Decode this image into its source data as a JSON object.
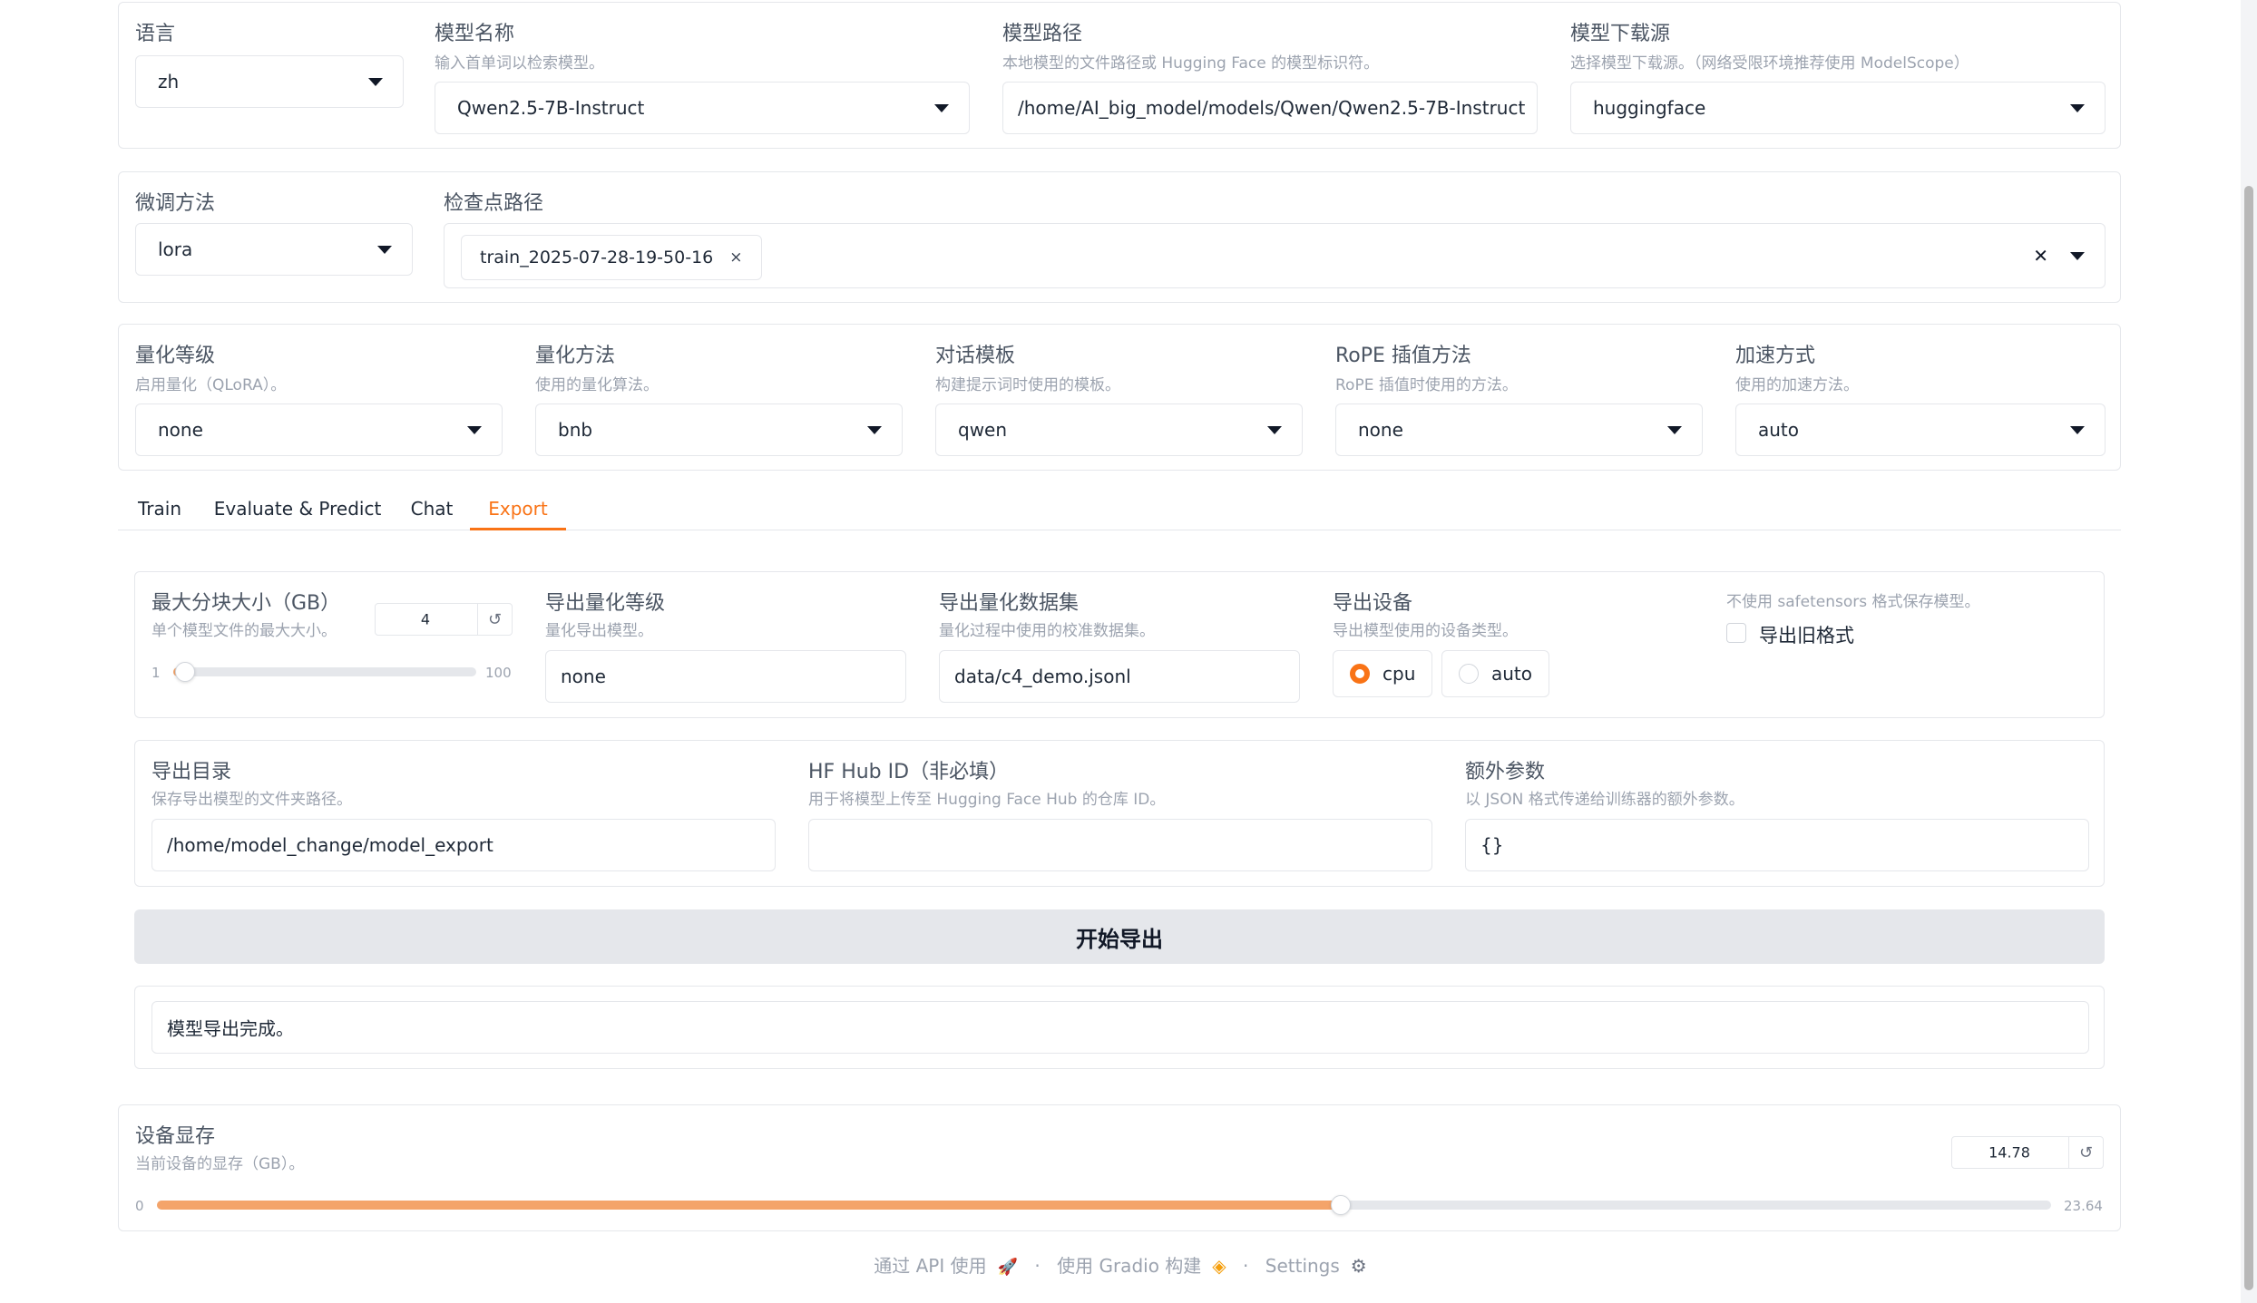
{
  "top": {
    "language": {
      "label": "语言",
      "value": "zh"
    },
    "model_name": {
      "label": "模型名称",
      "info": "输入首单词以检索模型。",
      "value": "Qwen2.5-7B-Instruct"
    },
    "model_path": {
      "label": "模型路径",
      "info": "本地模型的文件路径或 Hugging Face 的模型标识符。",
      "value": "/home/AI_big_model/models/Qwen/Qwen2.5-7B-Instruct"
    },
    "hub": {
      "label": "模型下载源",
      "info": "选择模型下载源。（网络受限环境推荐使用 ModelScope）",
      "value": "huggingface"
    }
  },
  "finetune": {
    "method": {
      "label": "微调方法",
      "value": "lora"
    },
    "checkpoint": {
      "label": "检查点路径",
      "chips": [
        "train_2025-07-28-19-50-16"
      ]
    }
  },
  "advanced": {
    "quant_bit": {
      "label": "量化等级",
      "info": "启用量化（QLoRA）。",
      "value": "none"
    },
    "quant_method": {
      "label": "量化方法",
      "info": "使用的量化算法。",
      "value": "bnb"
    },
    "template": {
      "label": "对话模板",
      "info": "构建提示词时使用的模板。",
      "value": "qwen"
    },
    "rope": {
      "label": "RoPE 插值方法",
      "info": "RoPE 插值时使用的方法。",
      "value": "none"
    },
    "booster": {
      "label": "加速方式",
      "info": "使用的加速方法。",
      "value": "auto"
    }
  },
  "tabs": [
    "Train",
    "Evaluate & Predict",
    "Chat",
    "Export"
  ],
  "export": {
    "shard_size": {
      "label": "最大分块大小（GB）",
      "info": "单个模型文件的最大大小。",
      "value": "4",
      "min": "1",
      "max": "100",
      "fraction": 0.03
    },
    "export_quant_bit": {
      "label": "导出量化等级",
      "info": "量化导出模型。",
      "value": "none"
    },
    "quant_dataset": {
      "label": "导出量化数据集",
      "info": "量化过程中使用的校准数据集。",
      "value": "data/c4_demo.jsonl"
    },
    "device": {
      "label": "导出设备",
      "info": "导出模型使用的设备类型。",
      "options": [
        "cpu",
        "auto"
      ],
      "selected": "cpu"
    },
    "legacy": {
      "info": "不使用 safetensors 格式保存模型。",
      "label": "导出旧格式",
      "checked": false
    },
    "export_dir": {
      "label": "导出目录",
      "info": "保存导出模型的文件夹路径。",
      "value": "/home/model_change/model_export"
    },
    "hub_id": {
      "label": "HF Hub ID（非必填）",
      "info": "用于将模型上传至 Hugging Face Hub 的仓库 ID。",
      "value": ""
    },
    "extra_args": {
      "label": "额外参数",
      "info": "以 JSON 格式传递给训练器的额外参数。",
      "value": "{}"
    },
    "button": "开始导出",
    "output": "模型导出完成。"
  },
  "device_memory": {
    "label": "设备显存",
    "info": "当前设备的显存（GB）。",
    "value": "14.78",
    "min": "0",
    "max": "23.64",
    "fraction": 0.625
  },
  "footer": {
    "api": "通过 API 使用",
    "built": "使用 Gradio 构建",
    "settings": "Settings",
    "sep": "·"
  },
  "icons": {
    "reset": "↺",
    "clear": "✕",
    "chip_close": "×",
    "rocket": "🚀",
    "gradio": "◈",
    "gear": "⚙"
  },
  "colors": {
    "accent": "#f97316",
    "slider_fill": "#f4a46a"
  }
}
